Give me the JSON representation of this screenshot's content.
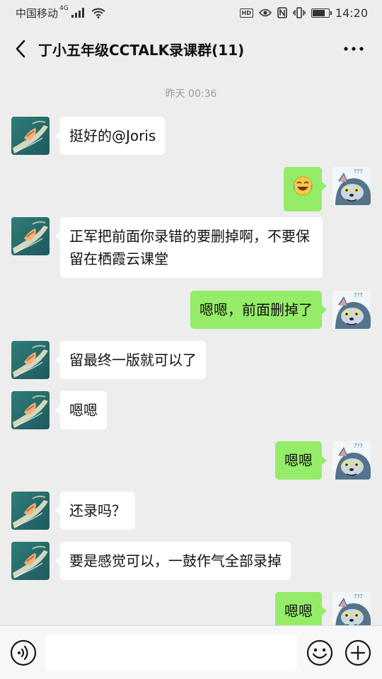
{
  "status_bar": {
    "carrier": "中国移动",
    "network": "4G",
    "time": "14:20",
    "hd_label": "HD",
    "battery_level": 0.8
  },
  "header": {
    "title": "丁小五年级CCTALK录课群(11)",
    "back_icon": "chevron-left-icon",
    "more_icon": "more-dots-icon"
  },
  "chat": {
    "timestamp": "昨天 00:36",
    "messages": [
      {
        "side": "in",
        "text": "挺好的@Joris"
      },
      {
        "side": "out",
        "text": "😂",
        "emoji": "laughing-crying-emoji"
      },
      {
        "side": "in",
        "text": "正军把前面你录错的要删掉啊，不要保留在栖霞云课堂"
      },
      {
        "side": "out",
        "text": "嗯嗯，前面删掉了"
      },
      {
        "side": "in",
        "text": "留最终一版就可以了"
      },
      {
        "side": "in",
        "text": "嗯嗯"
      },
      {
        "side": "out",
        "text": "嗯嗯"
      },
      {
        "side": "in",
        "text": "还录吗？"
      },
      {
        "side": "in",
        "text": "要是感觉可以，一鼓作气全部录掉"
      },
      {
        "side": "out",
        "text": "嗯嗯"
      }
    ]
  },
  "input_bar": {
    "voice_icon": "voice-icon",
    "emoji_icon": "emoji-icon",
    "plus_icon": "plus-icon",
    "placeholder": ""
  },
  "colors": {
    "background": "#ededed",
    "incoming_bubble": "#ffffff",
    "outgoing_bubble": "#95ec69"
  }
}
